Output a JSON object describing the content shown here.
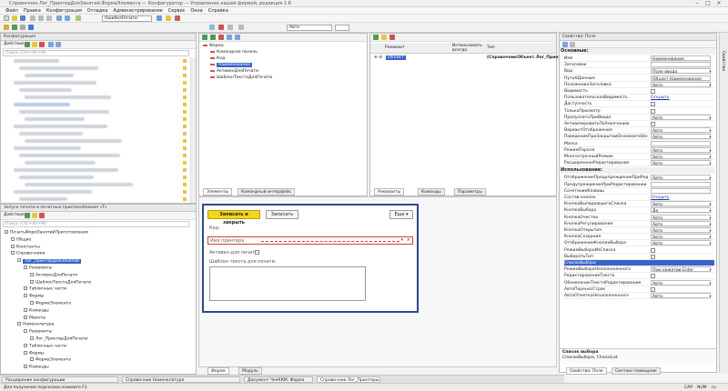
{
  "window": {
    "title": "Справочник.Лог_ПринтерДляЗанятий.ФормаЭлемента — Конфигуратор — Управление нашей фирмой, редакция 1.6"
  },
  "menu": [
    "Файл",
    "Правка",
    "Конфигурация",
    "Отладка",
    "Администрирование",
    "Сервис",
    "Окна",
    "Справка"
  ],
  "toolbar": {
    "search_combo": "ОшибкаПечати",
    "zoom_value": "Авто"
  },
  "config_tree": {
    "header": "Конфигурация",
    "actions_label": "Действия",
    "search_placeholder": "Поиск (Ctrl+Alt+M)"
  },
  "tree2": {
    "header": "Запуск печати и печатные приспособления «Т»",
    "actions_label": "Действия",
    "search_placeholder": "Поиск (Ctrl+Alt+M)",
    "items": [
      {
        "label": "ПечатьФормЗанятийПриготовления",
        "indent": 0
      },
      {
        "label": "Общие",
        "indent": 1
      },
      {
        "label": "Константы",
        "indent": 1
      },
      {
        "label": "Справочники",
        "indent": 1
      },
      {
        "label": "Лог_ПринтерДляЗанятий",
        "indent": 2,
        "selected": true
      },
      {
        "label": "Реквизиты",
        "indent": 3
      },
      {
        "label": "АктивенДляПечати",
        "indent": 4
      },
      {
        "label": "ШаблонТекстаДляПечати",
        "indent": 4
      },
      {
        "label": "Табличные части",
        "indent": 3
      },
      {
        "label": "Формы",
        "indent": 3
      },
      {
        "label": "ФормаЭлемента",
        "indent": 4
      },
      {
        "label": "Команды",
        "indent": 3
      },
      {
        "label": "Макеты",
        "indent": 3
      },
      {
        "label": "Номенклатура",
        "indent": 2
      },
      {
        "label": "Реквизиты",
        "indent": 3
      },
      {
        "label": "Лог_ПринтерДляПечати",
        "indent": 4
      },
      {
        "label": "Табличные части",
        "indent": 3
      },
      {
        "label": "Формы",
        "indent": 3
      },
      {
        "label": "ФормаЭлемента",
        "indent": 4
      },
      {
        "label": "Команды",
        "indent": 3
      }
    ]
  },
  "form_elements": {
    "items": [
      {
        "label": "Форма",
        "indent": 0
      },
      {
        "label": "Командная панель",
        "indent": 1
      },
      {
        "label": "Код",
        "indent": 1
      },
      {
        "label": "Наименование",
        "indent": 1,
        "selected": true
      },
      {
        "label": "АктивенДляПечати",
        "indent": 1
      },
      {
        "label": "ШаблонТекстаДляПечати",
        "indent": 1
      }
    ],
    "tabs": [
      "Элементы",
      "Командный интерфейс"
    ]
  },
  "requisites": {
    "col_name": "Реквизит",
    "col_use": "Использовать всегда",
    "col_type": "Тип",
    "row_name": "Объект",
    "row_type": "(СправочникОбъект.Лог_Прин...",
    "tabs": [
      "Реквизиты",
      "Команды",
      "Параметры"
    ]
  },
  "preview": {
    "save_close": "Записать и закрыть",
    "save": "Записать",
    "more": "Еще",
    "code_label": "Код:",
    "name_field": "Имя принтера",
    "active_label": "Активен для печати:",
    "template_label": "Шаблон текста для печати:"
  },
  "bottom_tabs": [
    "Форма",
    "Модуль"
  ],
  "properties": {
    "header": "Свойства: Поле",
    "group1": "Основные:",
    "group2": "Использование:",
    "rows1": [
      {
        "n": "Имя",
        "v": "Наименование",
        "k": "box"
      },
      {
        "n": "Заголовок",
        "v": "",
        "k": "box"
      },
      {
        "n": "Вид",
        "v": "Поле ввода",
        "k": "dd"
      },
      {
        "n": "ПутьКДанным",
        "v": "Объект.Наименование",
        "k": "box"
      },
      {
        "n": "ПоложениеЗаголовка",
        "v": "Авто",
        "k": "dd"
      },
      {
        "n": "Видимость",
        "v": "",
        "k": "cb"
      },
      {
        "n": "ПользовательскаяВидимость",
        "v": "Открыть",
        "k": "link"
      },
      {
        "n": "Доступность",
        "v": "",
        "k": "cb"
      },
      {
        "n": "ТолькоПросмотр",
        "v": "",
        "k": "cb"
      },
      {
        "n": "ПропускатьПриВводе",
        "v": "Авто",
        "k": "dd"
      },
      {
        "n": "АктивизироватьПоУмолчанию",
        "v": "",
        "k": "cb"
      },
      {
        "n": "ВариантОтображения",
        "v": "Авто",
        "k": "dd"
      },
      {
        "n": "ПоведениеПриЗакрытииОсновногоОкна",
        "v": "Авто",
        "k": "dd"
      },
      {
        "n": "Маска",
        "v": "",
        "k": "box"
      },
      {
        "n": "РежимПароля",
        "v": "Авто",
        "k": "dd"
      },
      {
        "n": "МногострочныйРежим",
        "v": "Авто",
        "k": "dd"
      },
      {
        "n": "РасширенноеРедактирование",
        "v": "Авто",
        "k": "dd"
      }
    ],
    "rows2": [
      {
        "n": "ОтображениеПредупрежденияПриРедактировании",
        "v": "Авто",
        "k": "dd"
      },
      {
        "n": "ПредупреждениеПриРедактировании",
        "v": "",
        "k": "box"
      },
      {
        "n": "СочетаниеКлавиш",
        "v": "",
        "k": "box"
      },
      {
        "n": "Состав кнопок",
        "v": "Открыть",
        "k": "link"
      },
      {
        "n": "КнопкаВыпадающегоСписка",
        "v": "Авто",
        "k": "dd"
      },
      {
        "n": "КнопкаВыбора",
        "v": "Да",
        "k": "dd"
      },
      {
        "n": "КнопкаОчистки",
        "v": "Авто",
        "k": "dd"
      },
      {
        "n": "КнопкаРегулирования",
        "v": "Авто",
        "k": "dd"
      },
      {
        "n": "КнопкаОткрытия",
        "v": "Авто",
        "k": "dd"
      },
      {
        "n": "КнопкаСоздания",
        "v": "Авто",
        "k": "dd"
      },
      {
        "n": "ОтображениеКнопкиВыбора",
        "v": "Авто",
        "k": "dd"
      },
      {
        "n": "РежимВыбораИзСписка",
        "v": "",
        "k": "cb"
      },
      {
        "n": "ВыбиратьТип",
        "v": "",
        "k": "cb"
      },
      {
        "n": "СписокВыбора",
        "v": "",
        "k": "sel"
      },
      {
        "n": "РежимВыбораНезаполненного",
        "v": "При нажатии Enter",
        "k": "dd"
      },
      {
        "n": "РедактированиеТекста",
        "v": "",
        "k": "cb"
      },
      {
        "n": "ОбновлениеТекстаРедактирования",
        "v": "Авто",
        "k": "dd"
      },
      {
        "n": "АвтоПереносСтрок",
        "v": "",
        "k": "cb"
      },
      {
        "n": "АвтоОтметкаНезаполненного",
        "v": "Авто",
        "k": "dd"
      }
    ],
    "description_title": "Список выбора",
    "description_text": "СписокВыбора, ChoiceList",
    "tabs": [
      "Свойства: Поле",
      "Синтакс-помощник"
    ]
  },
  "taskbar": [
    "Расширение конфигурации",
    "Справочник Номенклатура",
    "Документ ЧекККМ: Форма",
    "Справочник Лог_Принтеры..."
  ],
  "status": {
    "hint": "Для получения подсказки нажмите F1",
    "caps": "CAP",
    "num": "NUM",
    "lang": "ru"
  }
}
